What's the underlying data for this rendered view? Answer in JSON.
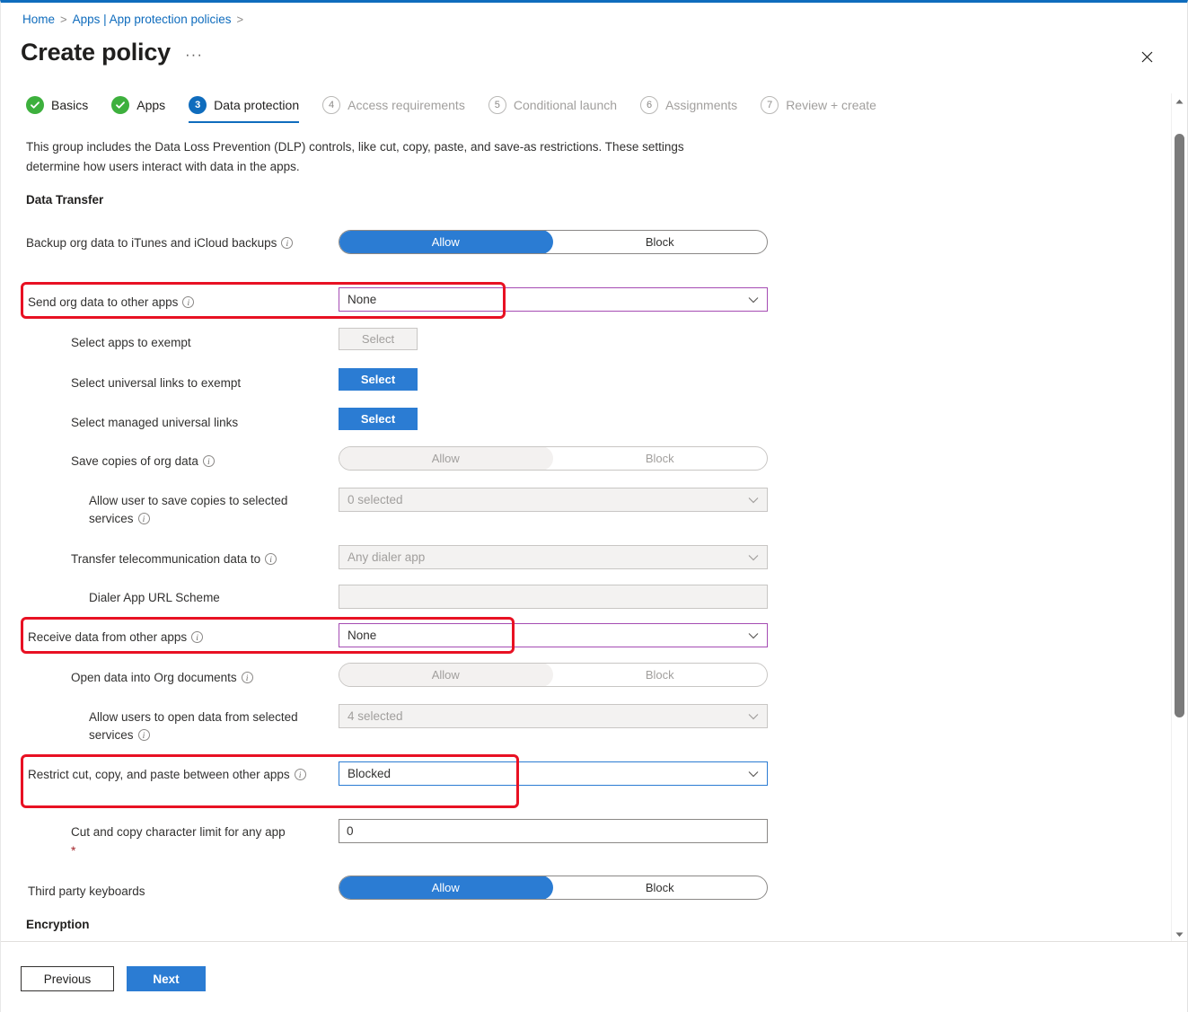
{
  "breadcrumb": {
    "items": [
      "Home",
      "Apps | App protection policies"
    ],
    "separator": ">"
  },
  "header": {
    "title": "Create policy",
    "ellipsis": "···",
    "close_icon": "close-icon"
  },
  "wizard": {
    "steps": [
      {
        "badge": "✓",
        "label": "Basics",
        "state": "done"
      },
      {
        "badge": "✓",
        "label": "Apps",
        "state": "done"
      },
      {
        "badge": "3",
        "label": "Data protection",
        "state": "current"
      },
      {
        "badge": "4",
        "label": "Access requirements",
        "state": "todo"
      },
      {
        "badge": "5",
        "label": "Conditional launch",
        "state": "todo"
      },
      {
        "badge": "6",
        "label": "Assignments",
        "state": "todo"
      },
      {
        "badge": "7",
        "label": "Review + create",
        "state": "todo"
      }
    ]
  },
  "main": {
    "intro": "This group includes the Data Loss Prevention (DLP) controls, like cut, copy, paste, and save-as restrictions. These settings determine how users interact with data in the apps.",
    "section_data_transfer": "Data Transfer",
    "section_encryption": "Encryption",
    "rows": {
      "backup_org_data": {
        "label": "Backup org data to iTunes and iCloud backups",
        "control": "toggle",
        "options": [
          "Allow",
          "Block"
        ],
        "selected": "Allow",
        "enabled": true
      },
      "send_org_data": {
        "label": "Send org data to other apps",
        "control": "dropdown",
        "value": "None",
        "enabled": true,
        "highlighted": true
      },
      "select_apps_exempt": {
        "label": "Select apps to exempt",
        "control": "button",
        "button_label": "Select",
        "enabled": false
      },
      "select_universal_links_exempt": {
        "label": "Select universal links to exempt",
        "control": "button",
        "button_label": "Select",
        "enabled": true
      },
      "select_managed_universal_links": {
        "label": "Select managed universal links",
        "control": "button",
        "button_label": "Select",
        "enabled": true
      },
      "save_copies": {
        "label": "Save copies of org data",
        "control": "toggle",
        "options": [
          "Allow",
          "Block"
        ],
        "selected": "Allow",
        "enabled": false
      },
      "allow_save_services": {
        "label": "Allow user to save copies to selected services",
        "control": "dropdown",
        "value": "0 selected",
        "enabled": false
      },
      "transfer_telecom": {
        "label": "Transfer telecommunication data to",
        "control": "dropdown",
        "value": "Any dialer app",
        "enabled": false
      },
      "dialer_url_scheme": {
        "label": "Dialer App URL Scheme",
        "control": "text",
        "value": "",
        "enabled": false
      },
      "receive_data": {
        "label": "Receive data from other apps",
        "control": "dropdown",
        "value": "None",
        "enabled": true,
        "highlighted": true
      },
      "open_data_org_docs": {
        "label": "Open data into Org documents",
        "control": "toggle",
        "options": [
          "Allow",
          "Block"
        ],
        "selected": "Allow",
        "enabled": false
      },
      "allow_open_services": {
        "label": "Allow users to open data from selected services",
        "control": "dropdown",
        "value": "4 selected",
        "enabled": false
      },
      "restrict_cut_copy_paste": {
        "label": "Restrict cut, copy, and paste between other apps",
        "control": "dropdown",
        "value": "Blocked",
        "enabled": true,
        "highlighted": true,
        "focused": true
      },
      "cut_copy_limit": {
        "label": "Cut and copy character limit for any app",
        "required_marker": "*",
        "control": "text",
        "value": "0",
        "enabled": true
      },
      "third_party_keyboards": {
        "label": "Third party keyboards",
        "control": "toggle",
        "options": [
          "Allow",
          "Block"
        ],
        "selected": "Allow",
        "enabled": true
      }
    }
  },
  "scrollbar": {
    "up_icon": "chevron-up-icon",
    "down_icon": "chevron-down-icon"
  },
  "footer": {
    "previous_label": "Previous",
    "next_label": "Next"
  },
  "colors": {
    "accent_blue": "#2b7cd3",
    "link_blue": "#0f6cbd",
    "success_green": "#3db03d",
    "highlight_red": "#e81123",
    "violet_border": "#a54cb3",
    "required_red": "#a4262c"
  }
}
